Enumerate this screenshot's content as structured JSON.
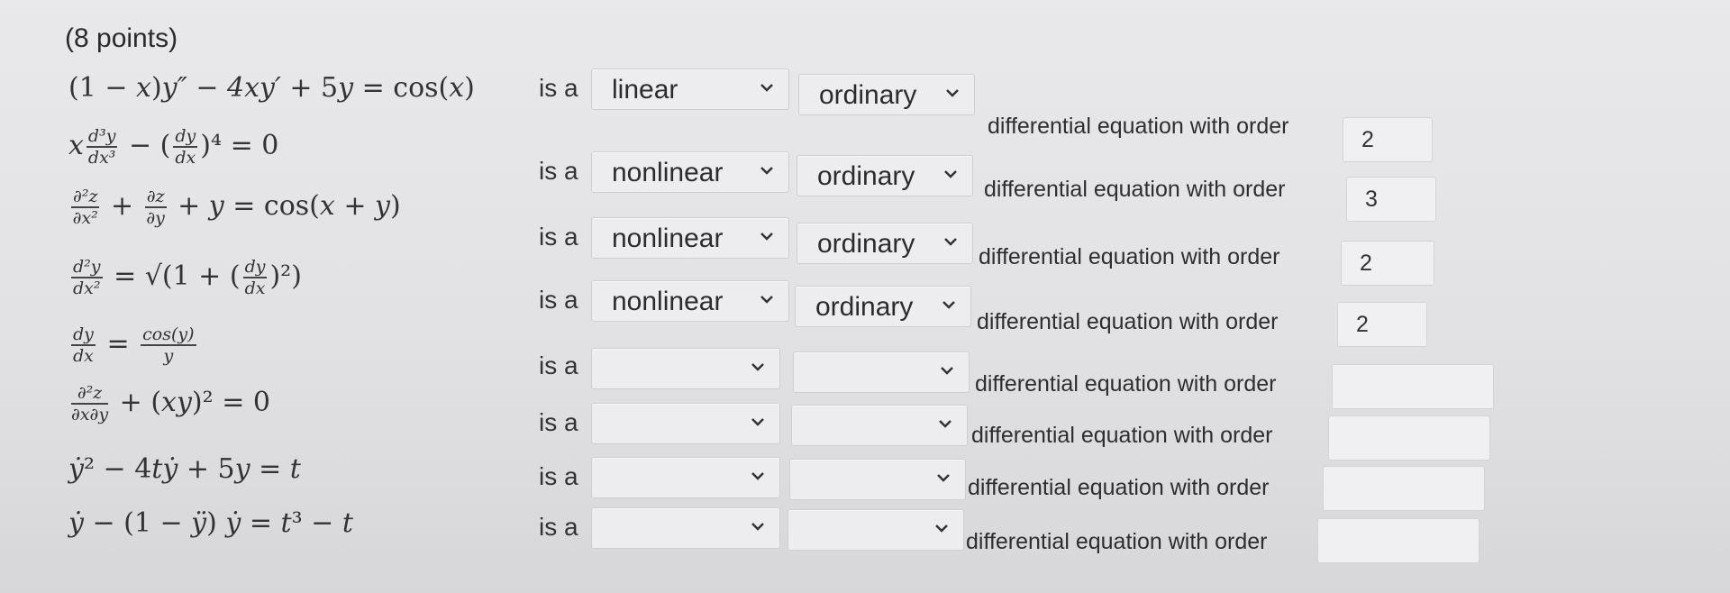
{
  "header": {
    "points": "(8 points)"
  },
  "common": {
    "is_a": "is a",
    "suffix": "differential equation with order"
  },
  "icons": {
    "chevron": "chevron-down-icon"
  },
  "rows": [
    {
      "linearity": "linear",
      "kind": "ordinary",
      "order": "2"
    },
    {
      "linearity": "nonlinear",
      "kind": "ordinary",
      "order": "3"
    },
    {
      "linearity": "nonlinear",
      "kind": "ordinary",
      "order": "2"
    },
    {
      "linearity": "nonlinear",
      "kind": "ordinary",
      "order": "2"
    },
    {
      "linearity": "",
      "kind": "",
      "order": ""
    },
    {
      "linearity": "",
      "kind": "",
      "order": ""
    },
    {
      "linearity": "",
      "kind": "",
      "order": ""
    },
    {
      "linearity": "",
      "kind": "",
      "order": ""
    }
  ]
}
